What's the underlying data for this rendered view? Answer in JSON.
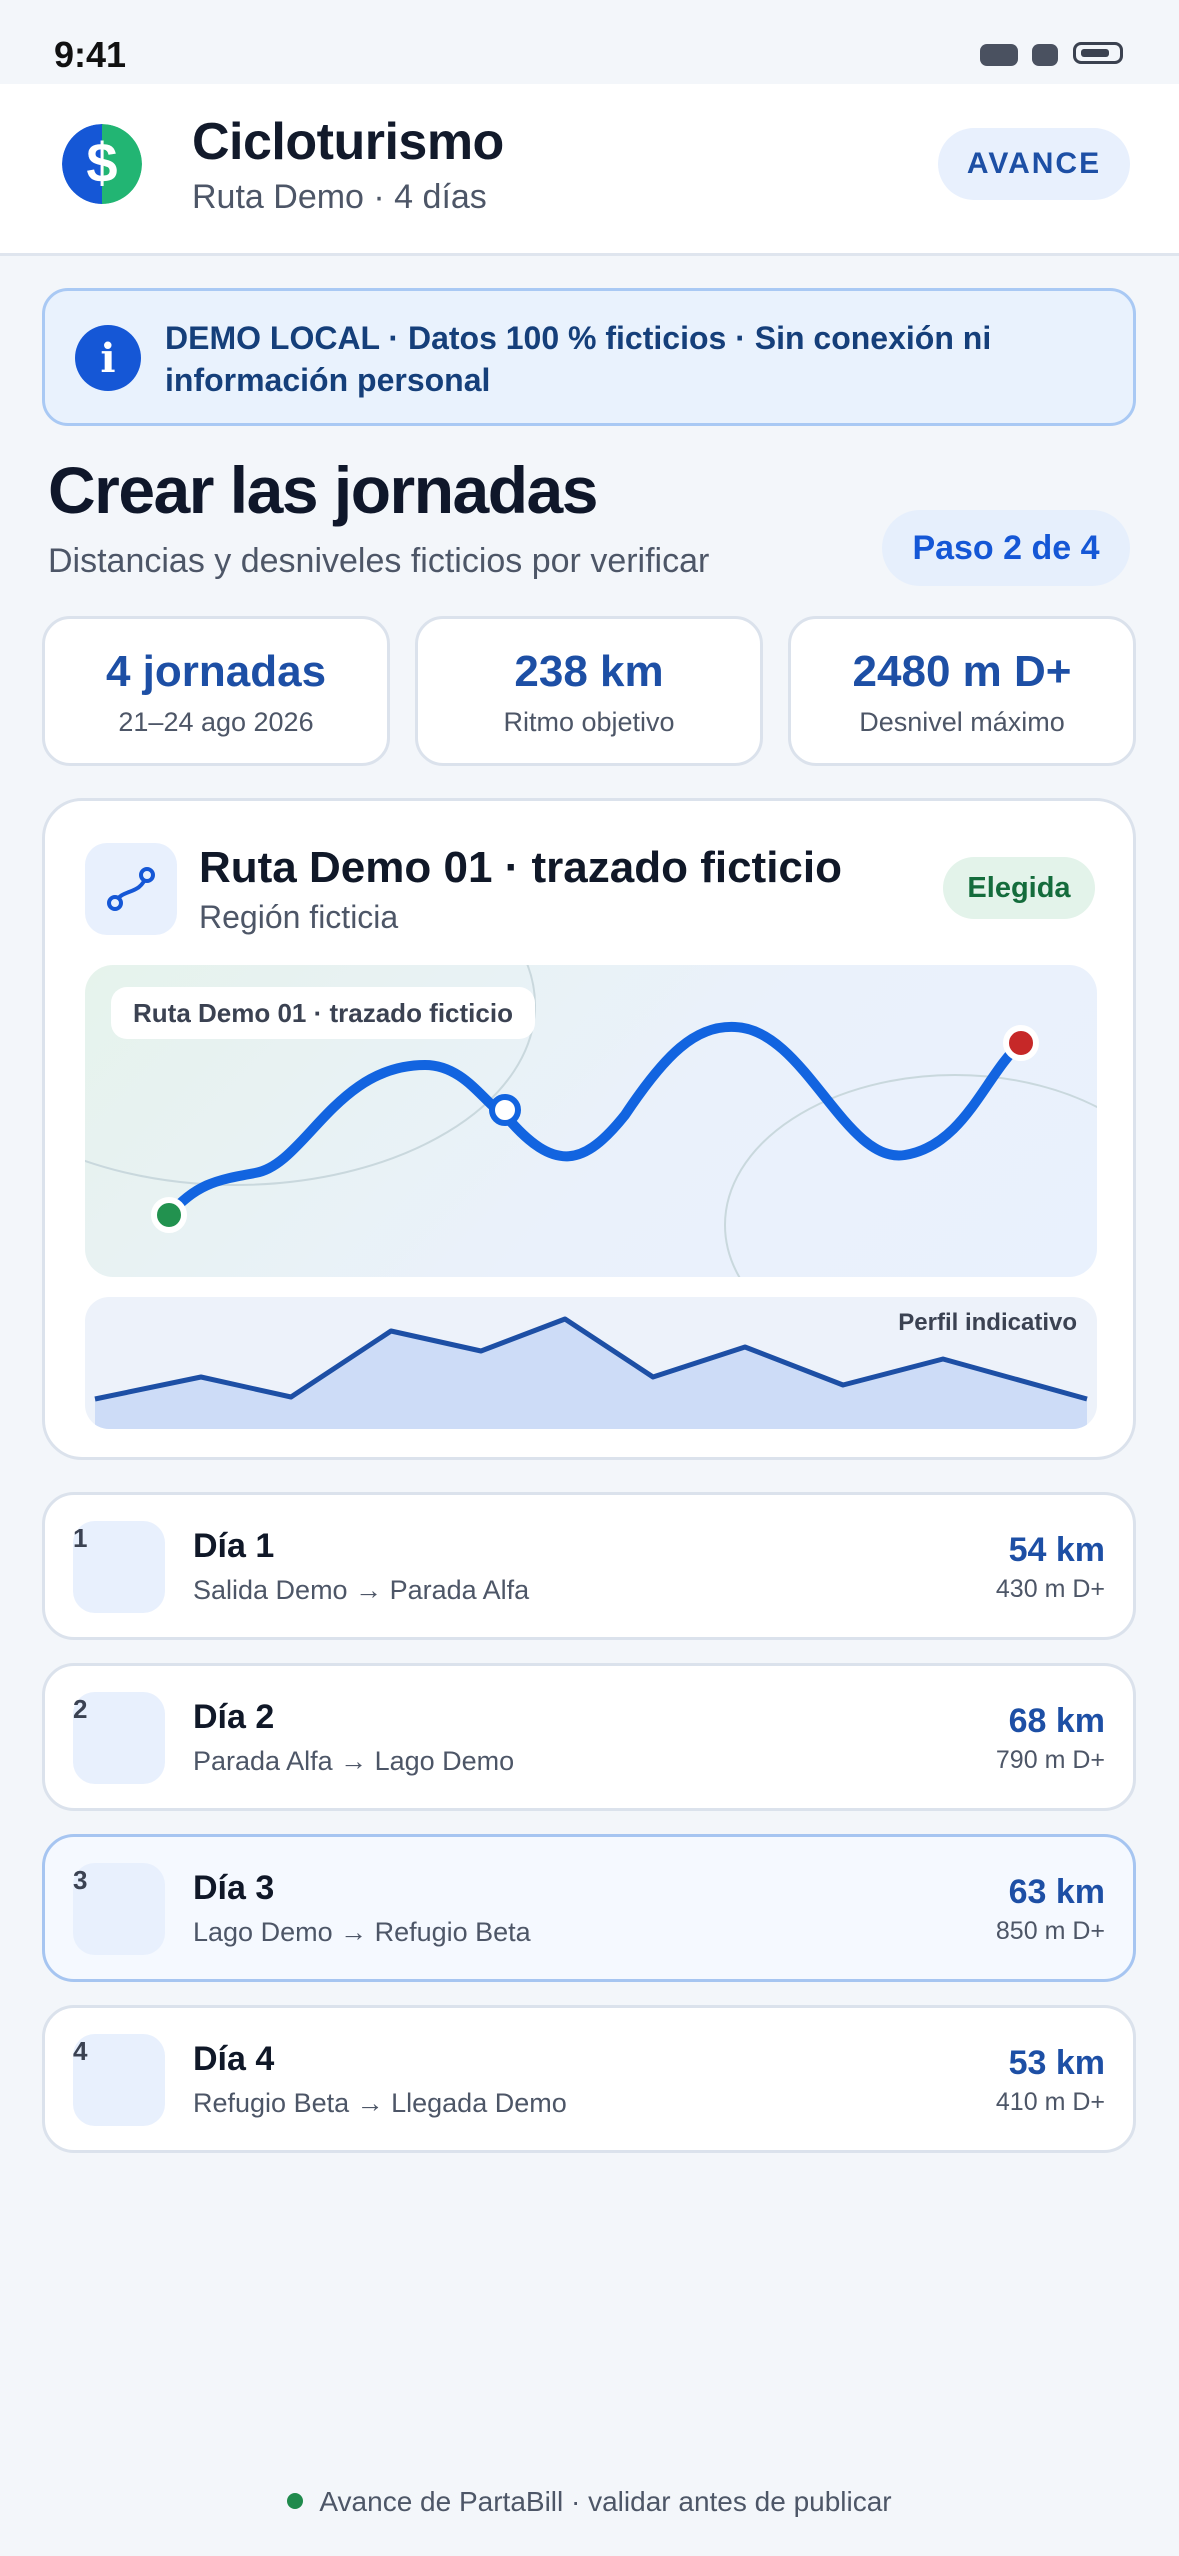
{
  "status_bar": {
    "time": "9:41"
  },
  "header": {
    "title": "Cicloturismo",
    "subtitle": "Ruta Demo · 4 días",
    "action_label": "AVANCE",
    "logo_glyph": "$"
  },
  "banner": {
    "icon": "info-icon",
    "icon_glyph": "i",
    "text": "DEMO LOCAL · Datos 100 % ficticios · Sin conexión ni información personal"
  },
  "page": {
    "title": "Crear las jornadas",
    "subtitle": "Distancias y desniveles ficticios por verificar",
    "step": "Paso 2 de 4"
  },
  "stats": [
    {
      "value": "4 jornadas",
      "label": "21–24 ago 2026"
    },
    {
      "value": "238 km",
      "label": "Ritmo objetivo"
    },
    {
      "value": "2480 m D+",
      "label": "Desnivel máximo"
    }
  ],
  "route": {
    "title": "Ruta Demo 01 · trazado ficticio",
    "region": "Región ficticia",
    "badge": "Elegida",
    "map_label": "Ruta Demo 01 · trazado ficticio",
    "profile_label": "Perfil indicativo"
  },
  "days": [
    {
      "num": "1",
      "name": "Día 1",
      "route": "Salida Demo → Parada Alfa",
      "km": "54 km",
      "gain": "430 m D+",
      "selected": false
    },
    {
      "num": "2",
      "name": "Día 2",
      "route": "Parada Alfa → Lago Demo",
      "km": "68 km",
      "gain": "790 m D+",
      "selected": false
    },
    {
      "num": "3",
      "name": "Día 3",
      "route": "Lago Demo → Refugio Beta",
      "km": "63 km",
      "gain": "850 m D+",
      "selected": true
    },
    {
      "num": "4",
      "name": "Día 4",
      "route": "Refugio Beta → Llegada Demo",
      "km": "53 km",
      "gain": "410 m D+",
      "selected": false
    }
  ],
  "footer": {
    "text": "Avance de PartaBill · validar antes de publicar"
  },
  "colors": {
    "accent": "#1557d6",
    "accent_text": "#1d4fa5",
    "success": "#1f8a4c",
    "danger": "#c62828",
    "background": "#f3f6fa"
  }
}
